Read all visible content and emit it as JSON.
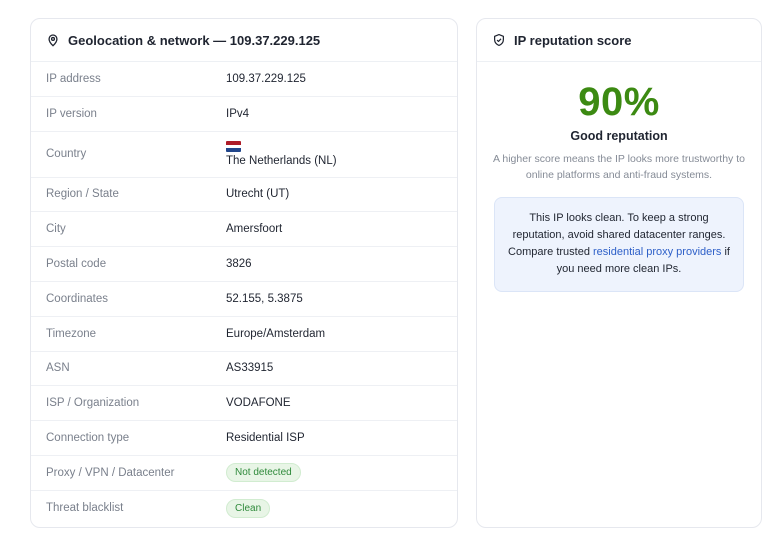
{
  "geo": {
    "title": "Geolocation & network — 109.37.229.125",
    "icon": "location-pin-icon",
    "rows": [
      {
        "label": "IP address",
        "value": "109.37.229.125"
      },
      {
        "label": "IP version",
        "value": "IPv4"
      },
      {
        "label": "Country",
        "value": "The Netherlands (NL)",
        "flag": [
          "#ae1c28",
          "#ffffff",
          "#21468b"
        ]
      },
      {
        "label": "Region / State",
        "value": "Utrecht (UT)"
      },
      {
        "label": "City",
        "value": "Amersfoort"
      },
      {
        "label": "Postal code",
        "value": "3826"
      },
      {
        "label": "Coordinates",
        "value": "52.155, 5.3875"
      },
      {
        "label": "Timezone",
        "value": "Europe/Amsterdam"
      },
      {
        "label": "ASN",
        "value": "AS33915"
      },
      {
        "label": "ISP / Organization",
        "value": "VODAFONE"
      },
      {
        "label": "Connection type",
        "value": "Residential ISP"
      },
      {
        "label": "Proxy / VPN / Datacenter",
        "value": "Not detected"
      },
      {
        "label": "Threat blacklist",
        "value": "Clean"
      }
    ]
  },
  "reputation": {
    "title": "IP reputation score",
    "icon": "shield-check-icon",
    "score": "90%",
    "score_color": "#3c8a12",
    "score_label": "Good reputation",
    "description": "A higher score means the IP looks more trustworthy to online platforms and anti-fraud systems.",
    "note": {
      "text_before": "This IP looks clean. To keep a strong reputation, avoid shared datacenter ranges. Compare trusted ",
      "link_text": "residential proxy providers",
      "text_after": " if you need more clean IPs."
    }
  },
  "colors": {
    "badge_green": "#2f8a3b",
    "link_blue": "#2d5fc8"
  }
}
